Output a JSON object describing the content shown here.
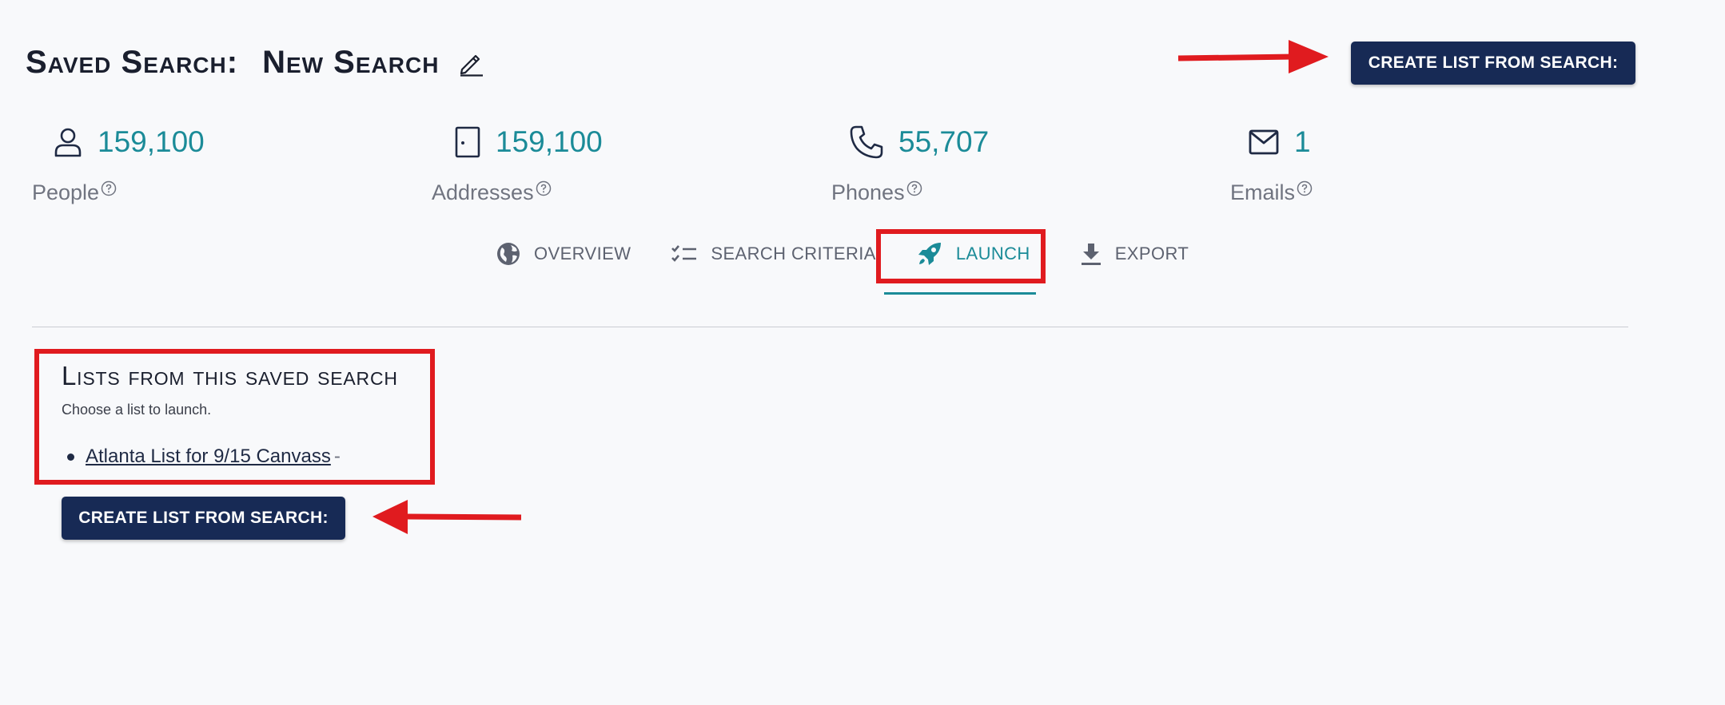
{
  "header": {
    "label": "Saved Search:",
    "name": "New Search",
    "create_button_label": "CREATE LIST FROM SEARCH:"
  },
  "stats": {
    "people": {
      "value": "159,100",
      "caption": "People"
    },
    "addresses": {
      "value": "159,100",
      "caption": "Addresses"
    },
    "phones": {
      "value": "55,707",
      "caption": "Phones"
    },
    "emails": {
      "value": "1",
      "caption": "Emails"
    }
  },
  "tabs": {
    "overview": "OVERVIEW",
    "search_criteria": "SEARCH CRITERIA",
    "launch": "LAUNCH",
    "export": "EXPORT",
    "active": "launch"
  },
  "lists": {
    "title": "Lists from this saved search",
    "subtitle": "Choose a list to launch.",
    "items": [
      {
        "label": "Atlanta List for 9/15 Canvass ",
        "suffix": "-"
      }
    ],
    "create_button_label": "CREATE LIST FROM SEARCH:"
  },
  "colors": {
    "accent": "#1b8b98",
    "button_bg": "#172a55",
    "annotation_red": "#e01b1f"
  },
  "icons": {
    "edit": "pencil-icon",
    "people": "person-icon",
    "addresses": "door-icon",
    "phones": "phone-icon",
    "emails": "mail-icon",
    "help": "help-circle-icon",
    "overview": "globe-icon",
    "search_criteria": "checklist-icon",
    "launch": "rocket-icon",
    "export": "download-icon"
  }
}
